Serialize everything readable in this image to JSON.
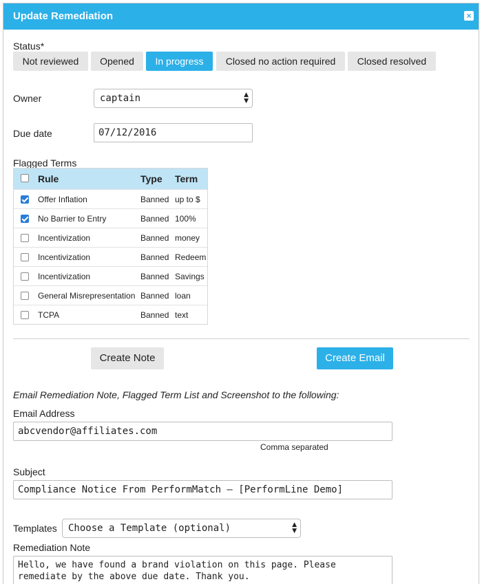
{
  "dialog": {
    "title": "Update Remediation",
    "close_icon": "×"
  },
  "status": {
    "label": "Status*",
    "options": [
      "Not reviewed",
      "Opened",
      "In progress",
      "Closed no action required",
      "Closed resolved"
    ],
    "selected": "In progress"
  },
  "owner": {
    "label": "Owner",
    "value": "captain"
  },
  "due_date": {
    "label": "Due date",
    "value": "07/12/2016"
  },
  "flagged_terms": {
    "label": "Flagged Terms",
    "columns": [
      "Rule",
      "Type",
      "Term"
    ],
    "rows": [
      {
        "rule": "Offer Inflation",
        "type": "Banned",
        "term": "up to $",
        "checked": true
      },
      {
        "rule": "No Barrier to Entry",
        "type": "Banned",
        "term": "100%",
        "checked": true
      },
      {
        "rule": "Incentivization",
        "type": "Banned",
        "term": "money",
        "checked": false
      },
      {
        "rule": "Incentivization",
        "type": "Banned",
        "term": "Redeem",
        "checked": false
      },
      {
        "rule": "Incentivization",
        "type": "Banned",
        "term": "Savings",
        "checked": false
      },
      {
        "rule": "General Misrepresentation",
        "type": "Banned",
        "term": "loan",
        "checked": false
      },
      {
        "rule": "TCPA",
        "type": "Banned",
        "term": "text",
        "checked": false
      }
    ]
  },
  "actions": {
    "create_note": "Create Note",
    "create_email": "Create Email"
  },
  "email": {
    "intro": "Email Remediation Note, Flagged Term List and Screenshot to the following:",
    "address_label": "Email Address",
    "address_value": "abcvendor@affiliates.com",
    "address_hint": "Comma separated",
    "subject_label": "Subject",
    "subject_value": "Compliance Notice From PerformMatch – [PerformLine Demo]",
    "templates_label": "Templates",
    "templates_value": "Choose a Template (optional)",
    "note_label": "Remediation Note",
    "note_value": "Hello, we have found a brand violation on this page. Please remediate by the above due date. Thank you."
  },
  "colors": {
    "accent": "#2cb0e8",
    "header_row": "#bfe4f5",
    "button_gray": "#e6e6e6",
    "checkbox": "#2b7cd6"
  }
}
